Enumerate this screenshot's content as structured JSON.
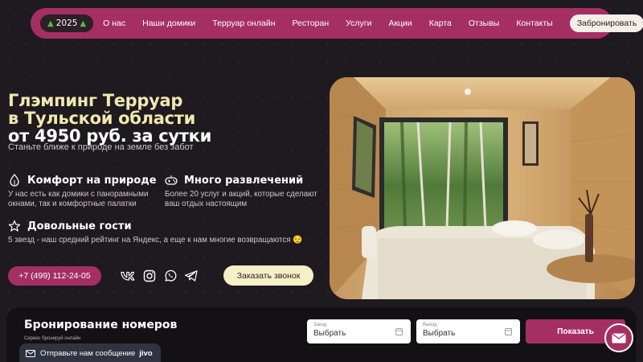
{
  "nav": {
    "year": "2025",
    "links": [
      "О нас",
      "Наши домики",
      "Терруар онлайн",
      "Ресторан",
      "Услуги",
      "Акции",
      "Карта",
      "Отзывы",
      "Контакты"
    ],
    "book_label": "Забронировать"
  },
  "hero": {
    "title_line1": "Глэмпинг Терруар",
    "title_line2": "в Тульской области",
    "title_line3": "от 4950 руб. за сутки",
    "subtitle": "Станьте ближе к природе на земле без забот"
  },
  "features": [
    {
      "title": "Комфорт на природе",
      "text": "У нас есть как домики с панорамными окнами, так и комфортные палатки",
      "icon": "leaf-drop-icon"
    },
    {
      "title": "Много развлечений",
      "text": "Более 20 услуг и акций, которые сделают ваш отдых настоящим",
      "icon": "gamepad-icon"
    },
    {
      "title": "Довольные гости",
      "text": "5 звезд - наш средний рейтинг на Яндекс, а еще к нам многие возвращаются 😌",
      "icon": "star-icon"
    }
  ],
  "contact": {
    "phone": "+7 (499) 112-24-05",
    "call_label": "Заказать звонок",
    "socials": [
      "vk-icon",
      "instagram-icon",
      "whatsapp-icon",
      "telegram-icon"
    ]
  },
  "booking": {
    "title": "Бронирование номеров",
    "subtitle": "Сервис бронируй онлайн",
    "checkin_label": "Заезд",
    "checkin_value": "Выбрать",
    "checkout_label": "Выезд",
    "checkout_value": "Выбрать",
    "submit_label": "Показать"
  },
  "chat": {
    "text": "Отправьте нам сообщение",
    "brand": "jivo"
  },
  "colors": {
    "accent": "#a52f63",
    "background": "#1e1a1f",
    "title": "#f2e7b0",
    "cream_button": "#f7efc6"
  }
}
